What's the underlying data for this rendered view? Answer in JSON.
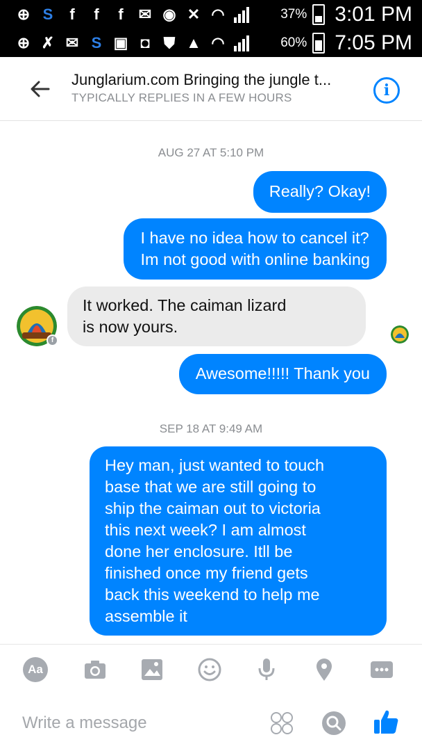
{
  "status_bar_top": {
    "icons": [
      "plus-icon",
      "s-icon",
      "facebook-icon",
      "facebook-icon",
      "facebook-icon",
      "mail-icon",
      "messenger-icon",
      "mute-icon",
      "wifi-icon",
      "signal-icon"
    ],
    "battery": "37%",
    "time": "3:01 PM"
  },
  "status_bar_bottom": {
    "icons": [
      "plus-icon",
      "missed-call-icon",
      "mail-icon",
      "s-icon",
      "image-icon",
      "instagram-icon",
      "shield-icon",
      "warning-icon",
      "wifi-icon",
      "signal-icon"
    ],
    "battery": "60%",
    "time": "7:05 PM"
  },
  "header": {
    "title": "Junglarium.com Bringing the jungle t...",
    "subtitle": "TYPICALLY REPLIES IN A FEW HOURS"
  },
  "chat": {
    "timestamp_1": "AUG 27 AT 5:10 PM",
    "msg_1_lines": [
      "Really? Okay!"
    ],
    "msg_2_lines": [
      "I have no idea how to cancel it?",
      "Im not good with online banking"
    ],
    "msg_3_lines": [
      "It worked. The caiman lizard",
      "is now yours."
    ],
    "msg_4_lines": [
      "Awesome!!!!! Thank you"
    ],
    "timestamp_2": "SEP 18 AT 9:49 AM",
    "msg_5_lines": [
      "Hey man, just wanted to touch",
      "base that we are still going to",
      "ship the caiman out to victoria",
      "this next week? I am almost",
      "done her enclosure. Itll be",
      "finished once my friend gets",
      "back this weekend to help me",
      "assemble it"
    ]
  },
  "toolbar": {
    "aa_label": "Aa",
    "icons": [
      "text-format-icon",
      "camera-icon",
      "gallery-icon",
      "emoji-icon",
      "microphone-icon",
      "location-icon",
      "more-icon"
    ]
  },
  "composer": {
    "placeholder": "Write a message",
    "icons": [
      "stickers-icon",
      "gif-search-icon",
      "like-thumb-icon"
    ]
  },
  "colors": {
    "accent": "#0084ff",
    "incoming_bubble": "#ebebeb",
    "muted_text": "#8a8d91"
  }
}
